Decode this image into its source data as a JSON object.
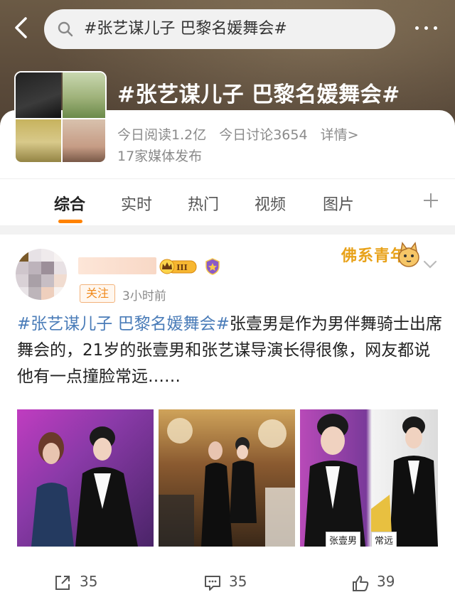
{
  "search": {
    "query": "#张艺谋儿子 巴黎名媛舞会#"
  },
  "topic": {
    "title": "#张艺谋儿子 巴黎名媛舞会#",
    "read_today": "今日阅读1.2亿",
    "discuss_today": "今日讨论3654",
    "details": "详情>",
    "media": "17家媒体发布"
  },
  "tabs": [
    "综合",
    "实时",
    "热门",
    "视频",
    "图片"
  ],
  "post": {
    "follow_label": "关注",
    "time": "3小时前",
    "badge_level": "III",
    "sticker": "佛系青年",
    "hashtag": "#张艺谋儿子 巴黎名媛舞会#",
    "text": "张壹男是作为男伴舞骑士出席舞会的，21岁的张壹男和张艺谋导演长得很像，网友都说他有一点撞脸常远……",
    "photo_captions": [
      "张壹男",
      "常远"
    ],
    "reposts": "35",
    "comments": "35",
    "likes": "39"
  },
  "colors": {
    "accent": "#ff8200",
    "link": "#4a7cb8",
    "follow": "#f08a1c"
  }
}
